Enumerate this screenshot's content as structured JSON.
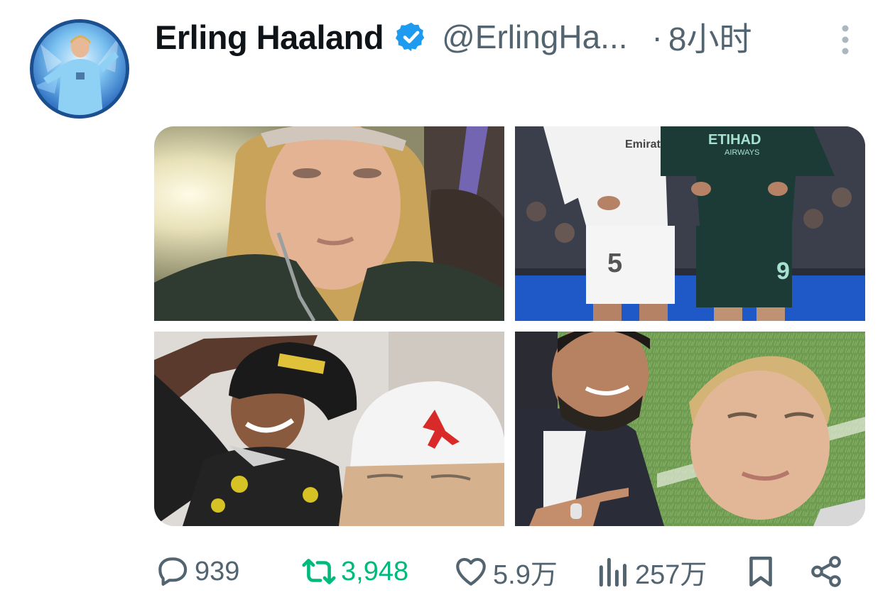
{
  "author": {
    "display_name": "Erling Haaland",
    "handle": "@ErlingHa...",
    "separator": "·",
    "time": "8小时",
    "verified": true
  },
  "icons": {
    "verified": "verified-badge-icon",
    "more": "more-vertical-icon",
    "reply": "reply-icon",
    "retweet": "retweet-icon",
    "like": "heart-icon",
    "views": "views-chart-icon",
    "bookmark": "bookmark-icon",
    "share": "share-icon"
  },
  "colors": {
    "verified": "#1d9bf0",
    "muted": "#536471",
    "retweeted": "#00ba7c",
    "text": "#0f1419"
  },
  "media": [
    {
      "description": "selfie-long-blond-hair"
    },
    {
      "description": "real-madrid-5-and-city-9-players"
    },
    {
      "description": "two-friends-selfie-beanie-and-bucket-hat"
    },
    {
      "description": "man-pointing-and-player-selfie"
    }
  ],
  "actions": {
    "reply_count": "939",
    "retweet_count": "3,948",
    "like_count": "5.9万",
    "view_count": "257万"
  }
}
